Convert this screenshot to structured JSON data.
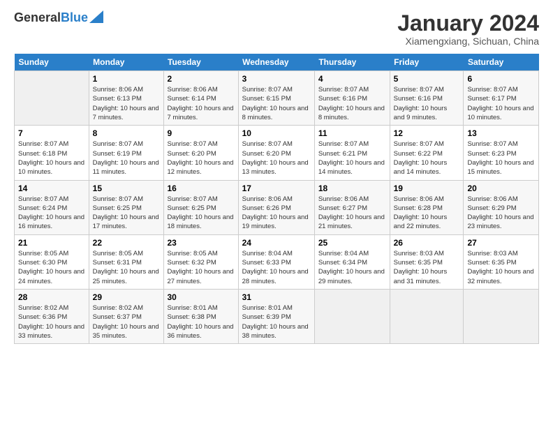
{
  "header": {
    "logo_general": "General",
    "logo_blue": "Blue",
    "title": "January 2024",
    "subtitle": "Xiamengxiang, Sichuan, China"
  },
  "columns": [
    "Sunday",
    "Monday",
    "Tuesday",
    "Wednesday",
    "Thursday",
    "Friday",
    "Saturday"
  ],
  "weeks": [
    [
      {
        "day": "",
        "sunrise": "",
        "sunset": "",
        "daylight": ""
      },
      {
        "day": "1",
        "sunrise": "Sunrise: 8:06 AM",
        "sunset": "Sunset: 6:13 PM",
        "daylight": "Daylight: 10 hours and 7 minutes."
      },
      {
        "day": "2",
        "sunrise": "Sunrise: 8:06 AM",
        "sunset": "Sunset: 6:14 PM",
        "daylight": "Daylight: 10 hours and 7 minutes."
      },
      {
        "day": "3",
        "sunrise": "Sunrise: 8:07 AM",
        "sunset": "Sunset: 6:15 PM",
        "daylight": "Daylight: 10 hours and 8 minutes."
      },
      {
        "day": "4",
        "sunrise": "Sunrise: 8:07 AM",
        "sunset": "Sunset: 6:16 PM",
        "daylight": "Daylight: 10 hours and 8 minutes."
      },
      {
        "day": "5",
        "sunrise": "Sunrise: 8:07 AM",
        "sunset": "Sunset: 6:16 PM",
        "daylight": "Daylight: 10 hours and 9 minutes."
      },
      {
        "day": "6",
        "sunrise": "Sunrise: 8:07 AM",
        "sunset": "Sunset: 6:17 PM",
        "daylight": "Daylight: 10 hours and 10 minutes."
      }
    ],
    [
      {
        "day": "7",
        "sunrise": "Sunrise: 8:07 AM",
        "sunset": "Sunset: 6:18 PM",
        "daylight": "Daylight: 10 hours and 10 minutes."
      },
      {
        "day": "8",
        "sunrise": "Sunrise: 8:07 AM",
        "sunset": "Sunset: 6:19 PM",
        "daylight": "Daylight: 10 hours and 11 minutes."
      },
      {
        "day": "9",
        "sunrise": "Sunrise: 8:07 AM",
        "sunset": "Sunset: 6:20 PM",
        "daylight": "Daylight: 10 hours and 12 minutes."
      },
      {
        "day": "10",
        "sunrise": "Sunrise: 8:07 AM",
        "sunset": "Sunset: 6:20 PM",
        "daylight": "Daylight: 10 hours and 13 minutes."
      },
      {
        "day": "11",
        "sunrise": "Sunrise: 8:07 AM",
        "sunset": "Sunset: 6:21 PM",
        "daylight": "Daylight: 10 hours and 14 minutes."
      },
      {
        "day": "12",
        "sunrise": "Sunrise: 8:07 AM",
        "sunset": "Sunset: 6:22 PM",
        "daylight": "Daylight: 10 hours and 14 minutes."
      },
      {
        "day": "13",
        "sunrise": "Sunrise: 8:07 AM",
        "sunset": "Sunset: 6:23 PM",
        "daylight": "Daylight: 10 hours and 15 minutes."
      }
    ],
    [
      {
        "day": "14",
        "sunrise": "Sunrise: 8:07 AM",
        "sunset": "Sunset: 6:24 PM",
        "daylight": "Daylight: 10 hours and 16 minutes."
      },
      {
        "day": "15",
        "sunrise": "Sunrise: 8:07 AM",
        "sunset": "Sunset: 6:25 PM",
        "daylight": "Daylight: 10 hours and 17 minutes."
      },
      {
        "day": "16",
        "sunrise": "Sunrise: 8:07 AM",
        "sunset": "Sunset: 6:25 PM",
        "daylight": "Daylight: 10 hours and 18 minutes."
      },
      {
        "day": "17",
        "sunrise": "Sunrise: 8:06 AM",
        "sunset": "Sunset: 6:26 PM",
        "daylight": "Daylight: 10 hours and 19 minutes."
      },
      {
        "day": "18",
        "sunrise": "Sunrise: 8:06 AM",
        "sunset": "Sunset: 6:27 PM",
        "daylight": "Daylight: 10 hours and 21 minutes."
      },
      {
        "day": "19",
        "sunrise": "Sunrise: 8:06 AM",
        "sunset": "Sunset: 6:28 PM",
        "daylight": "Daylight: 10 hours and 22 minutes."
      },
      {
        "day": "20",
        "sunrise": "Sunrise: 8:06 AM",
        "sunset": "Sunset: 6:29 PM",
        "daylight": "Daylight: 10 hours and 23 minutes."
      }
    ],
    [
      {
        "day": "21",
        "sunrise": "Sunrise: 8:05 AM",
        "sunset": "Sunset: 6:30 PM",
        "daylight": "Daylight: 10 hours and 24 minutes."
      },
      {
        "day": "22",
        "sunrise": "Sunrise: 8:05 AM",
        "sunset": "Sunset: 6:31 PM",
        "daylight": "Daylight: 10 hours and 25 minutes."
      },
      {
        "day": "23",
        "sunrise": "Sunrise: 8:05 AM",
        "sunset": "Sunset: 6:32 PM",
        "daylight": "Daylight: 10 hours and 27 minutes."
      },
      {
        "day": "24",
        "sunrise": "Sunrise: 8:04 AM",
        "sunset": "Sunset: 6:33 PM",
        "daylight": "Daylight: 10 hours and 28 minutes."
      },
      {
        "day": "25",
        "sunrise": "Sunrise: 8:04 AM",
        "sunset": "Sunset: 6:34 PM",
        "daylight": "Daylight: 10 hours and 29 minutes."
      },
      {
        "day": "26",
        "sunrise": "Sunrise: 8:03 AM",
        "sunset": "Sunset: 6:35 PM",
        "daylight": "Daylight: 10 hours and 31 minutes."
      },
      {
        "day": "27",
        "sunrise": "Sunrise: 8:03 AM",
        "sunset": "Sunset: 6:35 PM",
        "daylight": "Daylight: 10 hours and 32 minutes."
      }
    ],
    [
      {
        "day": "28",
        "sunrise": "Sunrise: 8:02 AM",
        "sunset": "Sunset: 6:36 PM",
        "daylight": "Daylight: 10 hours and 33 minutes."
      },
      {
        "day": "29",
        "sunrise": "Sunrise: 8:02 AM",
        "sunset": "Sunset: 6:37 PM",
        "daylight": "Daylight: 10 hours and 35 minutes."
      },
      {
        "day": "30",
        "sunrise": "Sunrise: 8:01 AM",
        "sunset": "Sunset: 6:38 PM",
        "daylight": "Daylight: 10 hours and 36 minutes."
      },
      {
        "day": "31",
        "sunrise": "Sunrise: 8:01 AM",
        "sunset": "Sunset: 6:39 PM",
        "daylight": "Daylight: 10 hours and 38 minutes."
      },
      {
        "day": "",
        "sunrise": "",
        "sunset": "",
        "daylight": ""
      },
      {
        "day": "",
        "sunrise": "",
        "sunset": "",
        "daylight": ""
      },
      {
        "day": "",
        "sunrise": "",
        "sunset": "",
        "daylight": ""
      }
    ]
  ]
}
